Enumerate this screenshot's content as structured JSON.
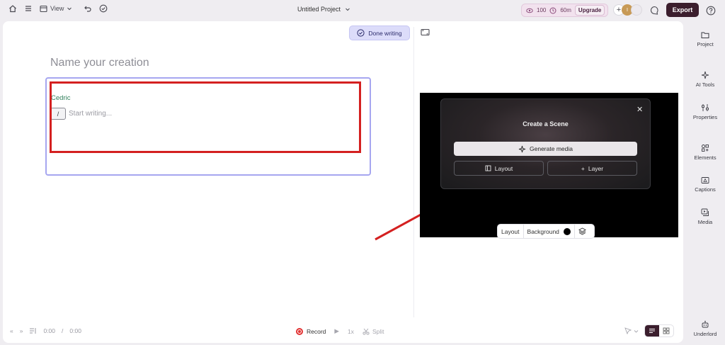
{
  "topbar": {
    "view_label": "View",
    "project_title": "Untitled Project",
    "credits_count": "100",
    "credits_minutes": "60m",
    "upgrade_label": "Upgrade",
    "avatar_initial": "I",
    "export_label": "Export"
  },
  "editor": {
    "done_label": "Done writing",
    "title_placeholder": "Name your creation",
    "speaker": "Cedric",
    "slash": "/",
    "placeholder": "Start writing..."
  },
  "scene_panel": {
    "title": "Create a Scene",
    "generate_label": "Generate media",
    "layout_label": "Layout",
    "layer_label": "Layer"
  },
  "preview_tools": {
    "layout_label": "Layout",
    "background_label": "Background",
    "background_color": "#000000"
  },
  "bottom": {
    "time_current": "0:00",
    "time_separator": "/",
    "time_total": "0:00",
    "record_label": "Record",
    "speed_label": "1x",
    "split_label": "Split"
  },
  "sidebar": {
    "items": [
      {
        "label": "Project",
        "icon": "folder-icon"
      },
      {
        "label": "AI Tools",
        "icon": "sparkle-icon"
      },
      {
        "label": "Properties",
        "icon": "sliders-icon"
      },
      {
        "label": "Elements",
        "icon": "shapes-icon"
      },
      {
        "label": "Captions",
        "icon": "captions-icon"
      },
      {
        "label": "Media",
        "icon": "media-icon"
      },
      {
        "label": "Underlord",
        "icon": "robot-icon"
      }
    ]
  },
  "colors": {
    "accent_dark": "#3b1e2d",
    "highlight_red": "#d42020",
    "editor_border": "#a6a6f0"
  }
}
